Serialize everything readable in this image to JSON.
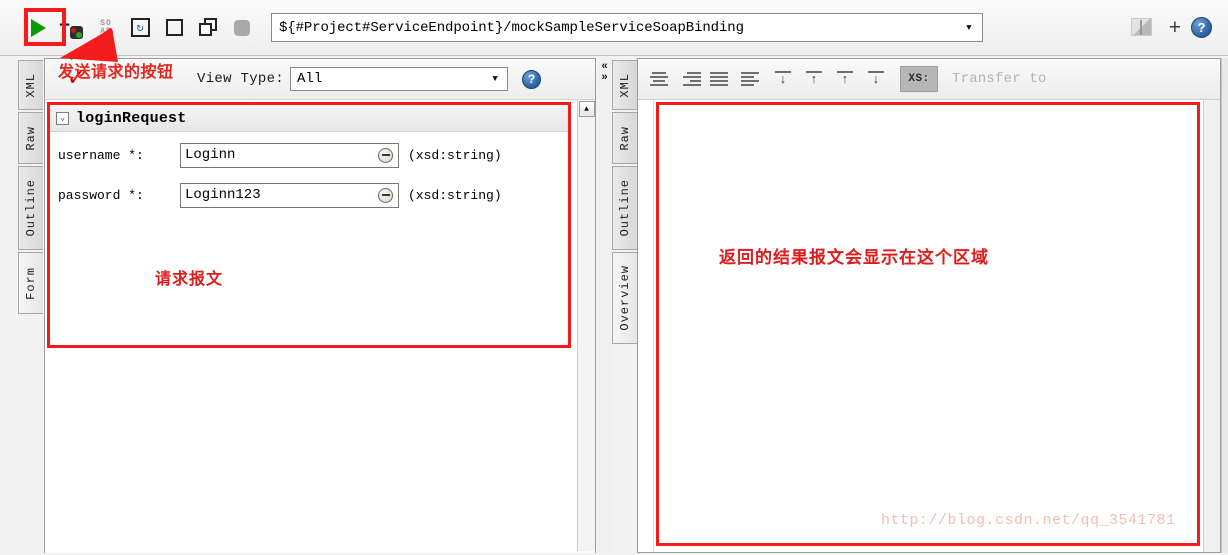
{
  "toolbar": {
    "buttons": [
      {
        "name": "submit-request",
        "icon": "green-play-triangle",
        "label": "Submit request"
      },
      {
        "name": "add-request",
        "icon": "add-request-icon",
        "label": "Add request"
      },
      {
        "name": "soap-toggle",
        "icon": "soap-icon",
        "label": "SOAP"
      },
      {
        "name": "recreate-request",
        "icon": "recreate-request-icon",
        "label": "Recreate request"
      },
      {
        "name": "stop-square",
        "icon": "square-icon",
        "label": "Stop"
      },
      {
        "name": "clone-request",
        "icon": "clone-icon",
        "label": "Clone"
      },
      {
        "name": "cancel-request",
        "icon": "rounded-square-icon",
        "label": "Cancel"
      }
    ],
    "soap_icon_line1": "SO",
    "soap_icon_line2": "AP",
    "recreate_glyph": "↻",
    "url_value": "${#Project#ServiceEndpoint}/mockSampleServiceSoapBinding",
    "url_arrow": "▼",
    "right_buttons": [
      {
        "name": "split-branch",
        "label": "Split"
      },
      {
        "name": "add",
        "label": "+"
      },
      {
        "name": "help",
        "label": "?"
      }
    ],
    "plus_glyph": "+",
    "help_glyph": "?"
  },
  "annotations": {
    "send_button_note": "发送请求的按钮",
    "request_message_note": "请求报文",
    "response_area_note": "返回的结果报文会显示在这个区域",
    "checkmark": "✓",
    "watermark": "http://blog.csdn.net/qq_3541781",
    "highlight_color": "#f31b1b",
    "text_color": "#e8231c"
  },
  "left": {
    "tabs": [
      "XML",
      "Raw",
      "Outline",
      "Form"
    ],
    "selected_tab": "Form",
    "view_type_label": "View Type:",
    "view_type_value": "All",
    "view_type_arrow": "▼",
    "help_glyph": "?",
    "form": {
      "collapse_glyph": "⌄",
      "title": "loginRequest",
      "fields": [
        {
          "label": "username *:",
          "value": "Loginn",
          "type": "(xsd:string)",
          "remove_icon": "minus-circle-icon"
        },
        {
          "label": "password *:",
          "value": "Loginn123",
          "type": "(xsd:string)",
          "remove_icon": "minus-circle-icon"
        }
      ]
    },
    "scroll_up_glyph": "▲"
  },
  "splitter": {
    "collapse_left_glyph": "«",
    "collapse_right_glyph": "»"
  },
  "right": {
    "tabs": [
      "XML",
      "Raw",
      "Outline",
      "Overview"
    ],
    "selected_tab": "Overview",
    "align_buttons": [
      {
        "name": "align-center",
        "label": "Align center"
      },
      {
        "name": "align-right",
        "label": "Align right"
      },
      {
        "name": "align-justify",
        "label": "Align justify"
      },
      {
        "name": "align-left",
        "label": "Align left"
      }
    ],
    "arrow_buttons": [
      {
        "name": "move-down-to-bar",
        "glyph": "↓"
      },
      {
        "name": "move-up-from-bar",
        "glyph": "↑"
      },
      {
        "name": "move-up-to-bar",
        "glyph": "↑"
      },
      {
        "name": "move-down-from-bar",
        "glyph": "↓"
      }
    ],
    "xs_button_label": "XS:",
    "transfer_label": "Transfer to"
  }
}
